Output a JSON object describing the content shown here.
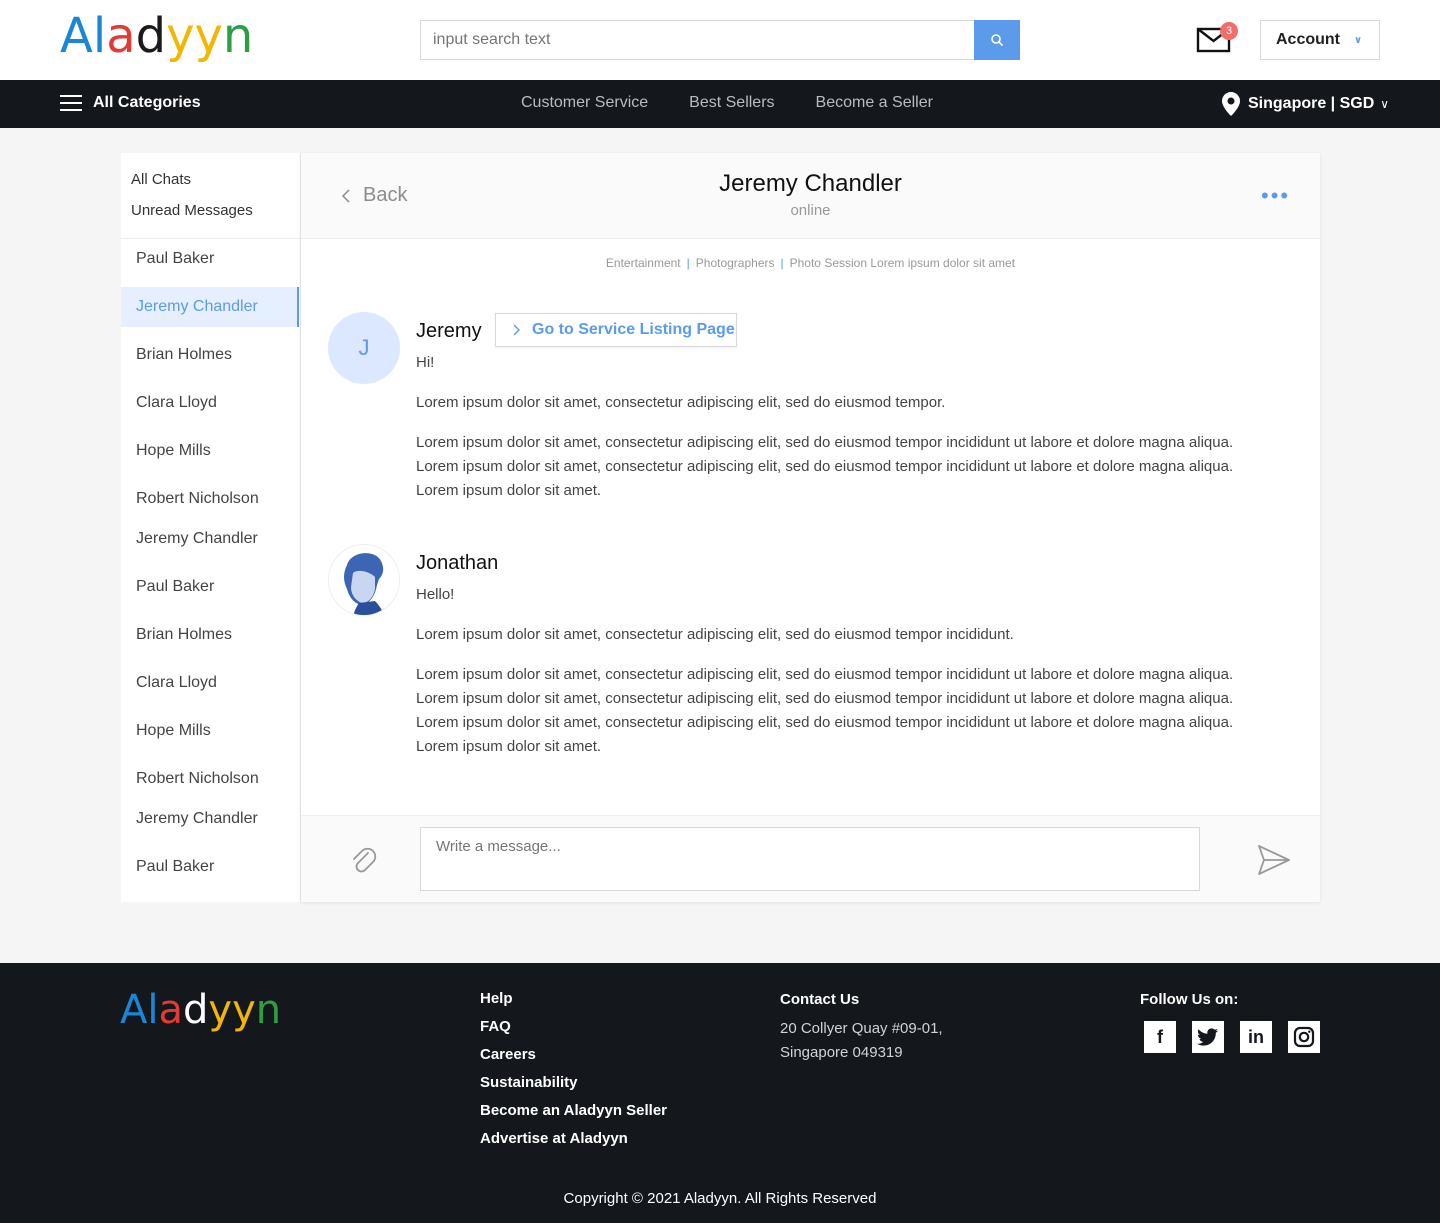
{
  "brand": {
    "letters": [
      {
        "ch": "A",
        "color": "#1a86d6"
      },
      {
        "ch": "l",
        "color": "#1a86d6"
      },
      {
        "ch": "a",
        "color": "#e53935"
      },
      {
        "ch": "d",
        "color": "#1a1a1a"
      },
      {
        "ch": "y",
        "color": "#f2b705"
      },
      {
        "ch": "y",
        "color": "#f2b705"
      },
      {
        "ch": "n",
        "color": "#2e9e43"
      }
    ],
    "accent": "#5b9bea"
  },
  "header": {
    "search_placeholder": "input search text",
    "mail_badge": "3",
    "account_label": "Account"
  },
  "nav": {
    "all_categories": "All Categories",
    "links": [
      "Customer Service",
      "Best Sellers",
      "Become a Seller"
    ],
    "locale": "Singapore | SGD"
  },
  "sidebar": {
    "filters": [
      "All Chats",
      "Unread Messages"
    ],
    "contacts": [
      {
        "name": "Paul Baker",
        "active": false
      },
      {
        "name": "Jeremy Chandler",
        "active": true
      },
      {
        "name": "Brian Holmes",
        "active": false
      },
      {
        "name": "Clara Lloyd",
        "active": false
      },
      {
        "name": "Hope Mills",
        "active": false
      },
      {
        "name": "Robert Nicholson",
        "active": false
      },
      {
        "name": "Jeremy Chandler",
        "active": false
      },
      {
        "name": "Paul Baker",
        "active": false
      },
      {
        "name": "Brian Holmes",
        "active": false
      },
      {
        "name": "Clara Lloyd",
        "active": false
      },
      {
        "name": "Hope Mills",
        "active": false
      },
      {
        "name": "Robert Nicholson",
        "active": false
      },
      {
        "name": "Jeremy Chandler",
        "active": false
      },
      {
        "name": "Paul Baker",
        "active": false
      }
    ]
  },
  "chat": {
    "back_label": "Back",
    "contact_name": "Jeremy Chandler",
    "status": "online",
    "breadcrumbs": [
      "Entertainment",
      "Photographers",
      "Photo Session Lorem ipsum dolor sit amet"
    ],
    "messages": [
      {
        "sender": "Jeremy",
        "avatar_initial": "J",
        "listing_button": "Go to Service Listing Page",
        "paragraphs": [
          "Hi!",
          "Lorem ipsum dolor sit amet, consectetur adipiscing elit, sed do eiusmod tempor.",
          "Lorem ipsum dolor sit amet, consectetur adipiscing elit, sed do eiusmod tempor incididunt ut labore et dolore magna aliqua. Lorem ipsum dolor sit amet, consectetur adipiscing elit, sed do eiusmod tempor incididunt ut labore et dolore magna aliqua. Lorem ipsum dolor sit amet."
        ]
      },
      {
        "sender": "Jonathan",
        "paragraphs": [
          "Hello!",
          "Lorem ipsum dolor sit amet, consectetur adipiscing elit, sed do eiusmod tempor incididunt.",
          "Lorem ipsum dolor sit amet, consectetur adipiscing elit, sed do eiusmod tempor incididunt ut labore et dolore magna aliqua. Lorem ipsum dolor sit amet, consectetur adipiscing elit, sed do eiusmod tempor incididunt ut labore et dolore magna aliqua. Lorem ipsum dolor sit amet, consectetur adipiscing elit, sed do eiusmod tempor incididunt ut labore et dolore magna aliqua. Lorem ipsum dolor sit amet."
        ]
      }
    ],
    "composer_placeholder": "Write a message..."
  },
  "footer": {
    "links": [
      "Help",
      "FAQ",
      "Careers",
      "Sustainability",
      "Become an Aladyyn Seller",
      "Advertise at Aladyyn"
    ],
    "contact_heading": "Contact Us",
    "address_line1": "20 Collyer Quay #09-01,",
    "address_line2": "Singapore 049319",
    "follow_heading": "Follow Us on:",
    "socials": [
      "facebook-icon",
      "twitter-icon",
      "linkedin-icon",
      "instagram-icon"
    ],
    "copyright": "Copyright © 2021 Aladyyn. All Rights Reserved"
  }
}
